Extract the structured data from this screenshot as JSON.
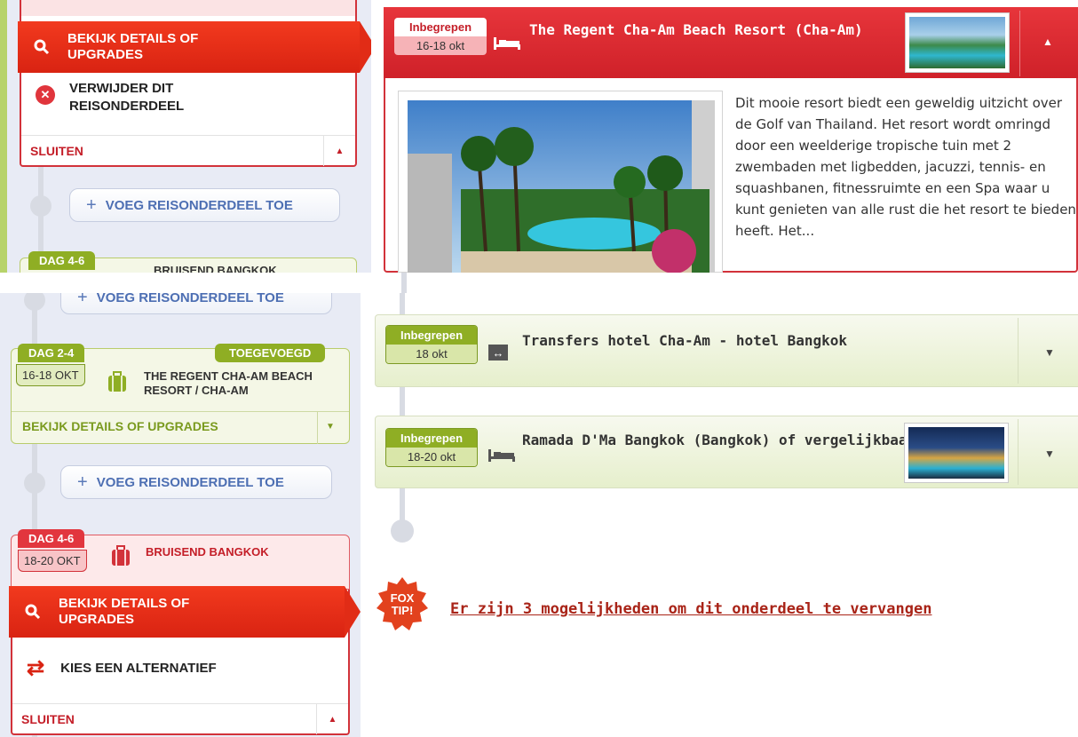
{
  "top_left": {
    "details_banner": "BEKIJK DETAILS OF UPGRADES",
    "remove_label": "VERWIJDER DIT REISONDERDEEL",
    "close_label": "SLUITEN",
    "add_label": "VOEG REISONDERDEEL TOE",
    "next_dag": "DAG 4-6",
    "next_title": "BRUISEND BANGKOK"
  },
  "top_right": {
    "tag_top": "Inbegrepen",
    "tag_bottom": "16-18 okt",
    "title": "The Regent Cha-Am Beach Resort (Cha-Am)",
    "description": "Dit mooie resort biedt een geweldig uitzicht over de Golf van Thailand. Het resort wordt omringd door een weelderige tropische tuin met 2 zwembaden met ligbedden, jacuzzi, tennis- en squashbanen, fitnessruimte en een Spa waar u kunt genieten van alle rust die het resort te bieden heeft. Het..."
  },
  "bottom_left": {
    "add_label_top": "VOEG REISONDERDEEL TOE",
    "card1": {
      "dag": "DAG 2-4",
      "status": "TOEGEVOEGD",
      "dates": "16-18 OKT",
      "title": "THE REGENT CHA-AM BEACH RESORT / CHA-AM",
      "details_label": "BEKIJK DETAILS OF UPGRADES"
    },
    "add_label_mid": "VOEG REISONDERDEEL TOE",
    "card2": {
      "dag": "DAG 4-6",
      "dates": "18-20 OKT",
      "title": "BRUISEND BANGKOK",
      "details_banner": "BEKIJK DETAILS OF UPGRADES",
      "alternative_label": "KIES EEN ALTERNATIEF",
      "close_label": "SLUITEN"
    }
  },
  "bottom_right": {
    "item1": {
      "tag_top": "Inbegrepen",
      "tag_bottom": "18 okt",
      "title": "Transfers hotel Cha-Am - hotel Bangkok"
    },
    "item2": {
      "tag_top": "Inbegrepen",
      "tag_bottom": "18-20 okt",
      "title": "Ramada D'Ma Bangkok (Bangkok) of vergelijkbaar"
    },
    "fox_badge": "FOX TIP!",
    "fox_link": "Er zijn 3 mogelijkheden om dit onderdeel te vervangen"
  },
  "colors": {
    "accent_red": "#d92312",
    "accent_green": "#8fae24",
    "link_red": "#a92418"
  }
}
